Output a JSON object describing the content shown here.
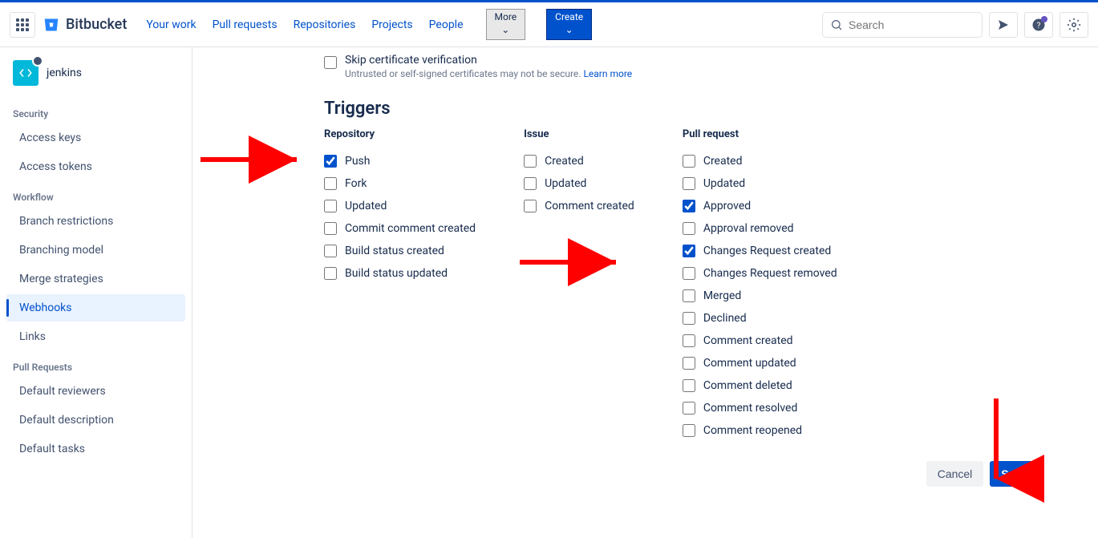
{
  "header": {
    "product": "Bitbucket",
    "nav": {
      "your_work": "Your work",
      "pull_requests": "Pull requests",
      "repositories": "Repositories",
      "projects": "Projects",
      "people": "People",
      "more": "More",
      "create": "Create"
    },
    "search_placeholder": "Search"
  },
  "sidebar": {
    "project": "jenkins",
    "sections": [
      {
        "title": "Security",
        "items": [
          {
            "label": "Access keys"
          },
          {
            "label": "Access tokens"
          }
        ]
      },
      {
        "title": "Workflow",
        "items": [
          {
            "label": "Branch restrictions"
          },
          {
            "label": "Branching model"
          },
          {
            "label": "Merge strategies"
          },
          {
            "label": "Webhooks",
            "active": true
          },
          {
            "label": "Links"
          }
        ]
      },
      {
        "title": "Pull Requests",
        "items": [
          {
            "label": "Default reviewers"
          },
          {
            "label": "Default description"
          },
          {
            "label": "Default tasks"
          }
        ]
      }
    ]
  },
  "form": {
    "cert": {
      "title": "Skip certificate verification",
      "sub": "Untrusted or self-signed certificates may not be secure.",
      "learn": "Learn more"
    },
    "triggers_heading": "Triggers",
    "columns": {
      "repository": {
        "title": "Repository",
        "items": [
          {
            "label": "Push",
            "checked": true
          },
          {
            "label": "Fork",
            "checked": false
          },
          {
            "label": "Updated",
            "checked": false
          },
          {
            "label": "Commit comment created",
            "checked": false
          },
          {
            "label": "Build status created",
            "checked": false
          },
          {
            "label": "Build status updated",
            "checked": false
          }
        ]
      },
      "issue": {
        "title": "Issue",
        "items": [
          {
            "label": "Created",
            "checked": false
          },
          {
            "label": "Updated",
            "checked": false
          },
          {
            "label": "Comment created",
            "checked": false
          }
        ]
      },
      "pull_request": {
        "title": "Pull request",
        "items": [
          {
            "label": "Created",
            "checked": false
          },
          {
            "label": "Updated",
            "checked": false
          },
          {
            "label": "Approved",
            "checked": true
          },
          {
            "label": "Approval removed",
            "checked": false
          },
          {
            "label": "Changes Request created",
            "checked": true
          },
          {
            "label": "Changes Request removed",
            "checked": false
          },
          {
            "label": "Merged",
            "checked": false
          },
          {
            "label": "Declined",
            "checked": false
          },
          {
            "label": "Comment created",
            "checked": false
          },
          {
            "label": "Comment updated",
            "checked": false
          },
          {
            "label": "Comment deleted",
            "checked": false
          },
          {
            "label": "Comment resolved",
            "checked": false
          },
          {
            "label": "Comment reopened",
            "checked": false
          }
        ]
      }
    },
    "buttons": {
      "cancel": "Cancel",
      "save": "Save"
    }
  }
}
